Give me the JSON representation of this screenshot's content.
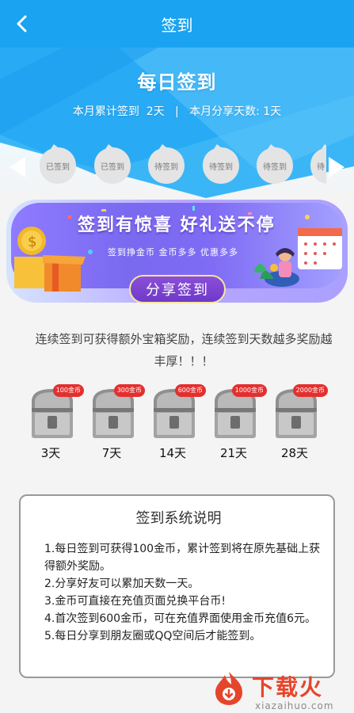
{
  "header": {
    "title": "签到"
  },
  "hero": {
    "title": "每日签到",
    "stats": "本月累计签到  2天   |   本月分享天数: 1天"
  },
  "days": [
    {
      "label": "已签到"
    },
    {
      "label": "已签到"
    },
    {
      "label": "待签到"
    },
    {
      "label": "待签到"
    },
    {
      "label": "待签到"
    },
    {
      "label": "待"
    }
  ],
  "banner": {
    "headline": "签到有惊喜  好礼送不停",
    "subtitle": "签到挣金币 金币多多 优惠多多",
    "share_label": "分享签到"
  },
  "intro": "连续签到可获得额外宝箱奖励，连续签到天数越多奖励越丰厚！！！",
  "chests": [
    {
      "reward": "100金币",
      "days": "3天"
    },
    {
      "reward": "300金币",
      "days": "7天"
    },
    {
      "reward": "600金币",
      "days": "14天"
    },
    {
      "reward": "1000金币",
      "days": "21天"
    },
    {
      "reward": "2000金币",
      "days": "28天"
    }
  ],
  "rules": {
    "title": "签到系统说明",
    "items": [
      "1.每日签到可获得100金币，累计签到将在原先基础上获得额外奖励。",
      "2.分享好友可以累加天数一天。",
      "3.金币可直接在充值页面兑换平台币!",
      "4.首次签到600金币，可在充值界面使用金币充值6元。",
      "5.每日分享到朋友圈或QQ空间后才能签到。"
    ]
  },
  "watermark": {
    "name": "下载火",
    "url": "xiazaihuo.com"
  },
  "colors": {
    "header": "#1aa3f0",
    "banner": "#7a6af0",
    "badge_red": "#e42f2f",
    "brand": "#e5452b"
  }
}
